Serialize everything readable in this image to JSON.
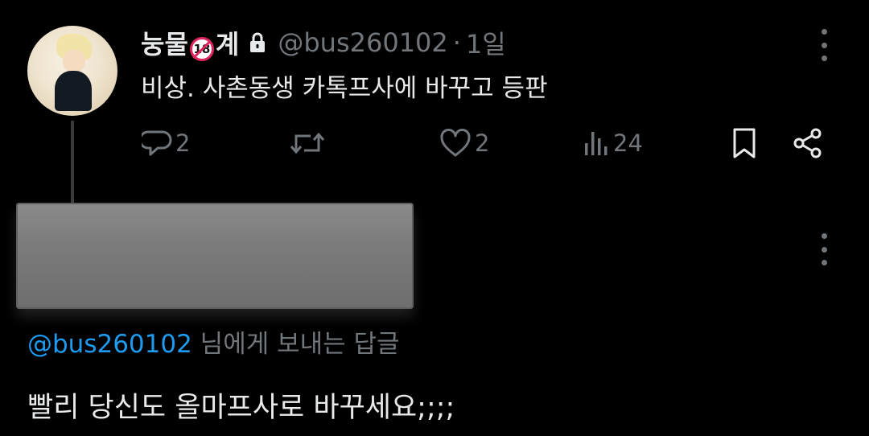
{
  "tweet": {
    "name_part1": "눙물",
    "name_badge": "18",
    "name_part2": "계",
    "handle": "@bus260102",
    "separator": "·",
    "time": "1일",
    "text": "비상. 사촌동생 카톡프사에 바꾸고 등판",
    "replies": "2",
    "likes": "2",
    "views": "24",
    "icons": {
      "lock": "lock-icon",
      "reply": "reply-icon",
      "retweet": "retweet-icon",
      "like": "heart-icon",
      "views": "views-icon",
      "bookmark": "bookmark-icon",
      "share": "share-icon",
      "more": "more-icon"
    }
  },
  "reply": {
    "replying_to_handle": "@bus260102",
    "replying_to_suffix": " 님에게 보내는 답글",
    "text": "빨리 당신도 올마프사로 바꾸세요;;;;"
  },
  "colors": {
    "background": "#000000",
    "text": "#e7e9ea",
    "muted": "#71767b",
    "accent": "#1d9bf0"
  }
}
